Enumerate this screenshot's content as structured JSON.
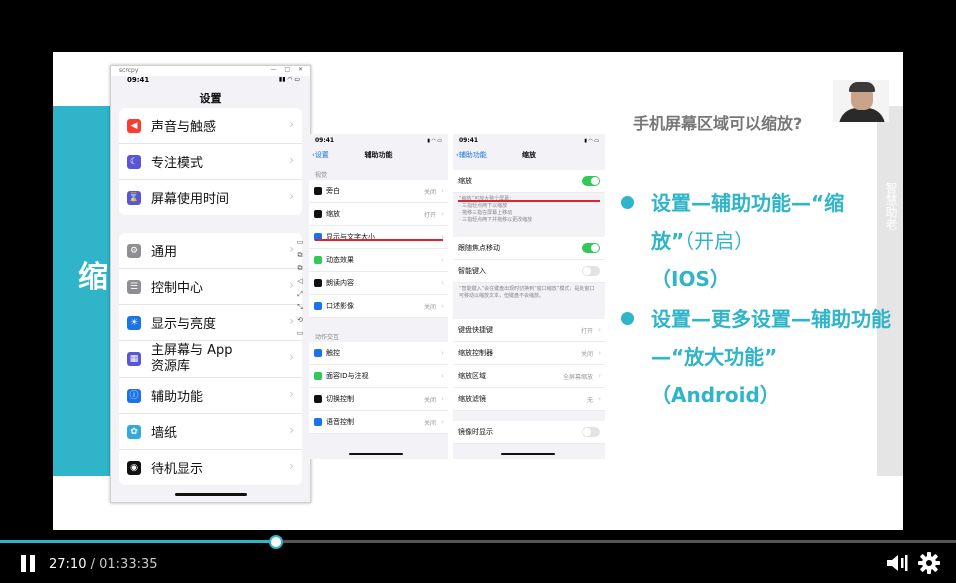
{
  "slide": {
    "title": "手机屏幕区域可以缩放?",
    "left_char": "缩",
    "right_bar_text": "智慧助老",
    "bullets": [
      {
        "part1": "设置—辅助功能—“缩放”",
        "part2": "（开启）",
        "part3": "（IOS）"
      },
      {
        "part1": "设置—更多设置—辅助功能—“放大功能”",
        "part2": "（Android）"
      }
    ]
  },
  "phone_window": {
    "app_name": "scrcpy",
    "controls": "— □ ✕",
    "time": "09:41",
    "status_icons": "▮▮ ◠ ▭",
    "header": "设置",
    "group1": [
      {
        "label": "声音与触感",
        "icon": "speaker-icon",
        "color": "#ff3b30"
      },
      {
        "label": "专注模式",
        "icon": "moon-icon",
        "color": "#5856d6"
      },
      {
        "label": "屏幕使用时间",
        "icon": "hourglass-icon",
        "color": "#5856d6"
      }
    ],
    "group2": [
      {
        "label": "通用",
        "icon": "gear-icon",
        "color": "#8e8e93"
      },
      {
        "label": "控制中心",
        "icon": "toggles-icon",
        "color": "#8e8e93"
      },
      {
        "label": "显示与亮度",
        "icon": "sun-icon",
        "color": "#1a73e8"
      },
      {
        "label": "主屏幕与 App\n资源库",
        "icon": "grid-icon",
        "color": "#5856d6"
      },
      {
        "label": "辅助功能",
        "icon": "accessibility-icon",
        "color": "#1a73e8"
      },
      {
        "label": "墙纸",
        "icon": "flower-icon",
        "color": "#34aadc"
      },
      {
        "label": "待机显示",
        "icon": "standby-icon",
        "color": "#111111"
      }
    ],
    "side_tools": [
      "▭",
      "⧉",
      "⧉",
      "◁",
      "⤢",
      "⤡",
      "⟲",
      "▭"
    ]
  },
  "accessibility_screen": {
    "time": "09:41",
    "back": "设置",
    "title": "辅助功能",
    "section1": "视觉",
    "rows1": [
      {
        "label": "旁白",
        "value": "关闭",
        "color": "#111111"
      },
      {
        "label": "缩放",
        "value": "打开",
        "color": "#111111"
      },
      {
        "label": "显示与文字大小",
        "value": "",
        "color": "#1a73e8"
      },
      {
        "label": "动态效果",
        "value": "",
        "color": "#34c759"
      },
      {
        "label": "朗读内容",
        "value": "",
        "color": "#111111"
      },
      {
        "label": "口述影像",
        "value": "关闭",
        "color": "#1a73e8"
      }
    ],
    "section2": "动作交互",
    "rows2": [
      {
        "label": "触控",
        "value": "",
        "color": "#1a73e8"
      },
      {
        "label": "面容ID与注视",
        "value": "",
        "color": "#34c759"
      },
      {
        "label": "切换控制",
        "value": "关闭",
        "color": "#111111"
      },
      {
        "label": "语音控制",
        "value": "关闭",
        "color": "#1a73e8"
      }
    ]
  },
  "zoom_screen": {
    "time": "09:41",
    "back": "辅助功能",
    "title": "缩放",
    "zoom_label": "缩放",
    "zoom_desc": "“缩放”可放大整个屏幕：\n· 三指轻点两下以缩放\n· 拖移三指在屏幕上移动\n· 三指轻点两下并拖移以更改缩放",
    "follow_focus": "跟随焦点移动",
    "smart_typing": "智能键入",
    "smart_desc": "“智能键入”会在键盘出现时切换到“窗口缩放”模式，是处窗口可移动以缩放文本，但键盘不会缩放。",
    "rows": [
      {
        "label": "键盘快捷键",
        "value": "打开"
      },
      {
        "label": "缩放控制器",
        "value": "关闭"
      },
      {
        "label": "缩放区域",
        "value": "全屏幕缩放"
      },
      {
        "label": "缩放滤镜",
        "value": "无"
      }
    ],
    "last_row": "镜像时显示"
  },
  "player": {
    "current": "27:10",
    "separator": " / ",
    "duration": "01:33:35",
    "progress_fraction": 0.289,
    "accent": "#2fb4c9"
  }
}
